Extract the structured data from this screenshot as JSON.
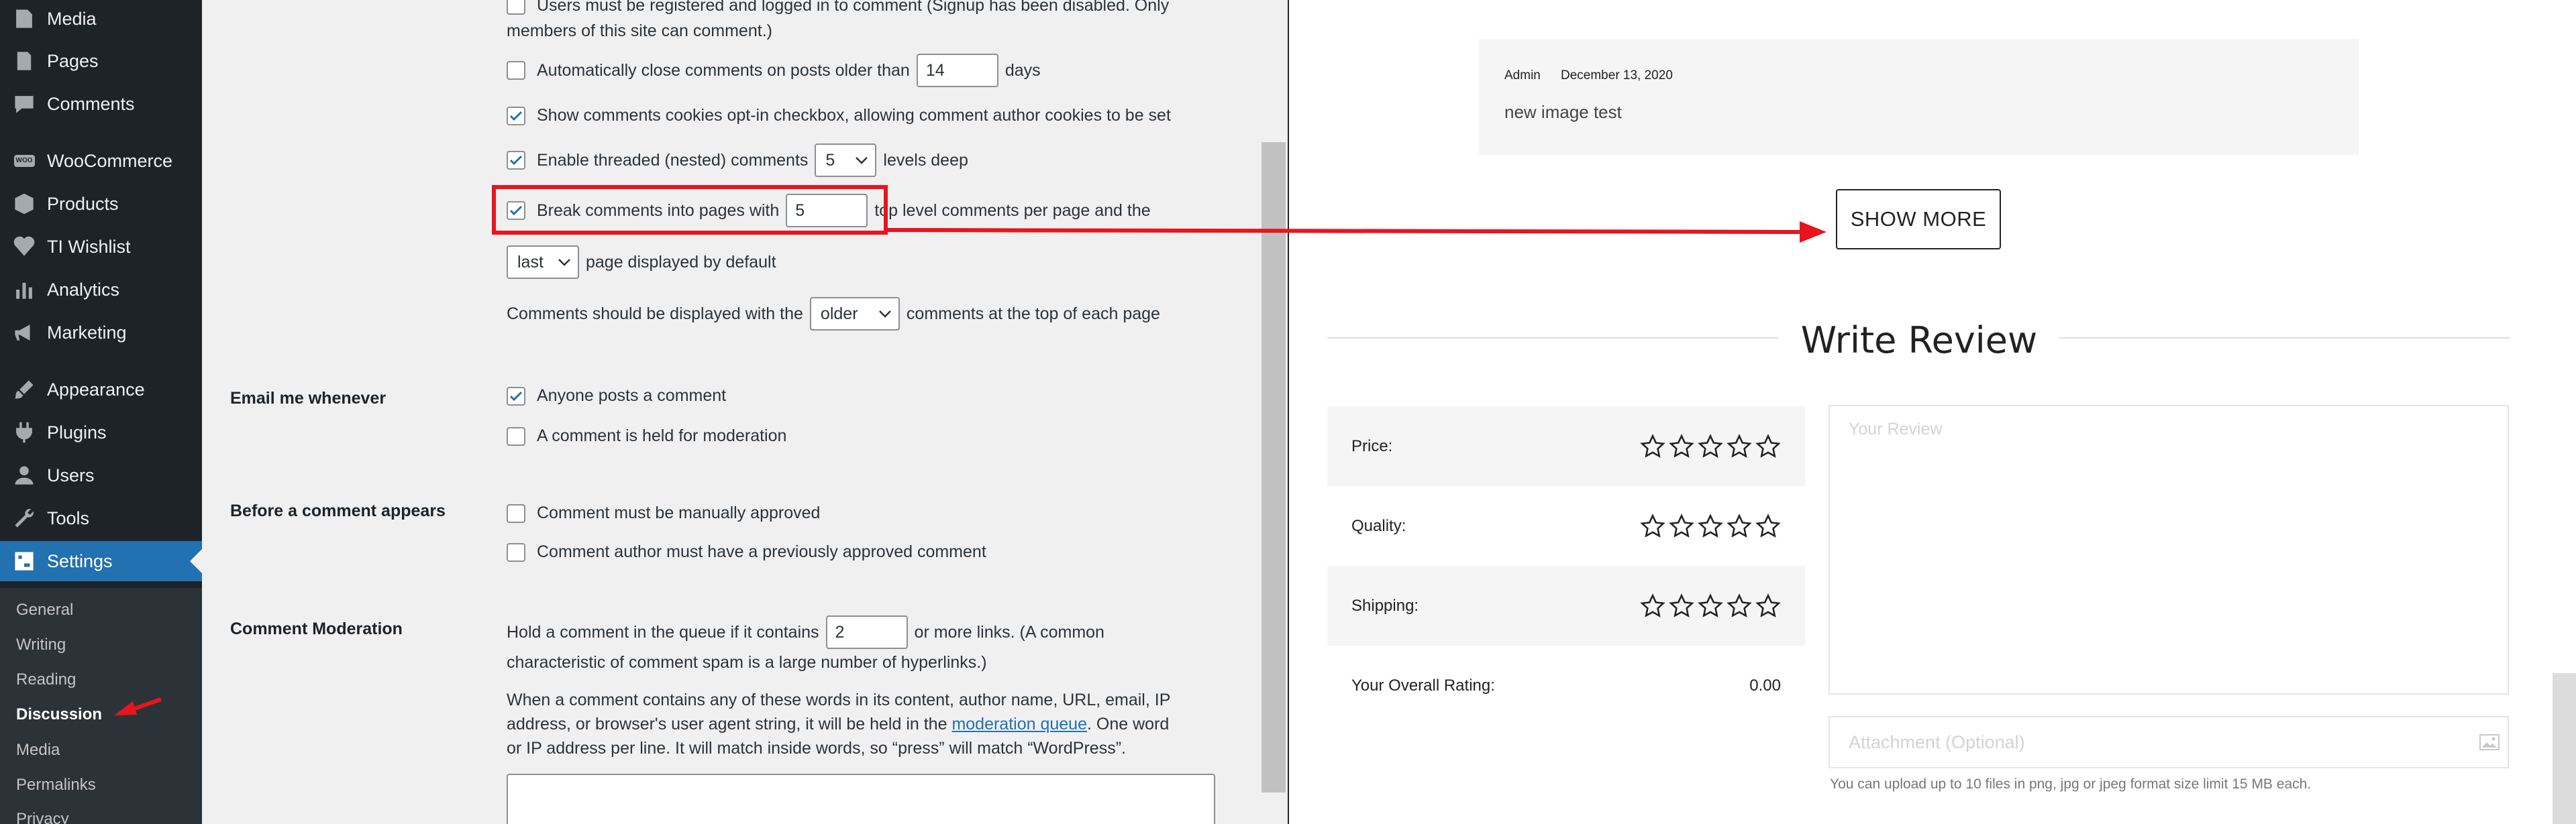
{
  "sidebar": {
    "items": [
      {
        "label": "Media",
        "icon": "media-icon"
      },
      {
        "label": "Pages",
        "icon": "pages-icon"
      },
      {
        "label": "Comments",
        "icon": "comments-icon"
      },
      {
        "label": "WooCommerce",
        "icon": "woocommerce-icon"
      },
      {
        "label": "Products",
        "icon": "products-icon"
      },
      {
        "label": "TI Wishlist",
        "icon": "wishlist-icon"
      },
      {
        "label": "Analytics",
        "icon": "analytics-icon"
      },
      {
        "label": "Marketing",
        "icon": "marketing-icon"
      },
      {
        "label": "Appearance",
        "icon": "appearance-icon"
      },
      {
        "label": "Plugins",
        "icon": "plugins-icon"
      },
      {
        "label": "Users",
        "icon": "users-icon"
      },
      {
        "label": "Tools",
        "icon": "tools-icon"
      },
      {
        "label": "Settings",
        "icon": "settings-icon"
      }
    ],
    "woo_badge": "WOO",
    "submenu": [
      "General",
      "Writing",
      "Reading",
      "Discussion",
      "Media",
      "Permalinks",
      "Privacy"
    ],
    "colors": {
      "bg": "#1d2327",
      "current": "#2271b1",
      "submenu_bg": "#2c3338"
    }
  },
  "discussion": {
    "registered_text_1": "Users must be registered and logged in to comment (Signup has been disabled. Only",
    "registered_text_2": "members of this site can comment.)",
    "auto_close": {
      "before": "Automatically close comments on posts older than",
      "value": "14",
      "after": "days"
    },
    "cookies": "Show comments cookies opt-in checkbox, allowing comment author cookies to be set",
    "threaded": {
      "before": "Enable threaded (nested) comments",
      "value": "5",
      "after": "levels deep"
    },
    "paged": {
      "before": "Break comments into pages with",
      "value": "5",
      "after": "top level comments per page and the"
    },
    "page_default": {
      "value": "last",
      "after": "page displayed by default"
    },
    "order": {
      "before": "Comments should be displayed with the",
      "value": "older",
      "after": "comments at the top of each page"
    },
    "email_label": "Email me whenever",
    "email_anyone": "Anyone posts a comment",
    "email_held": "A comment is held for moderation",
    "before_label": "Before a comment appears",
    "manual_approve": "Comment must be manually approved",
    "prev_approved": "Comment author must have a previously approved comment",
    "moderation_label": "Comment Moderation",
    "mod_links": {
      "before": "Hold a comment in the queue if it contains",
      "value": "2",
      "after": "or more links. (A common"
    },
    "mod_links_2": "characteristic of comment spam is a large number of hyperlinks.)",
    "mod_words_1": "When a comment contains any of these words in its content, author name, URL, email, IP",
    "mod_words_2a": "address, or browser's user agent string, it will be held in the",
    "mod_queue_link": "moderation queue",
    "mod_words_2b": ". One word",
    "mod_words_3": "or IP address per line. It will match inside words, so “press” will match “WordPress”."
  },
  "store": {
    "comment": {
      "author": "Admin",
      "date": "December 13, 2020",
      "text": "new image test"
    },
    "show_more": "SHOW MORE",
    "write_review": "Write Review",
    "ratings": [
      {
        "label": "Price:",
        "stars": 5
      },
      {
        "label": "Quality:",
        "stars": 5
      },
      {
        "label": "Shipping:",
        "stars": 5
      }
    ],
    "overall_label": "Your Overall Rating:",
    "overall_value": "0.00",
    "review_placeholder": "Your Review",
    "attachment_placeholder": "Attachment (Optional)",
    "upload_note": "You can upload up to 10 files in png, jpg or jpeg format size limit 15 MB each."
  },
  "annotation_color": "#e8141e"
}
